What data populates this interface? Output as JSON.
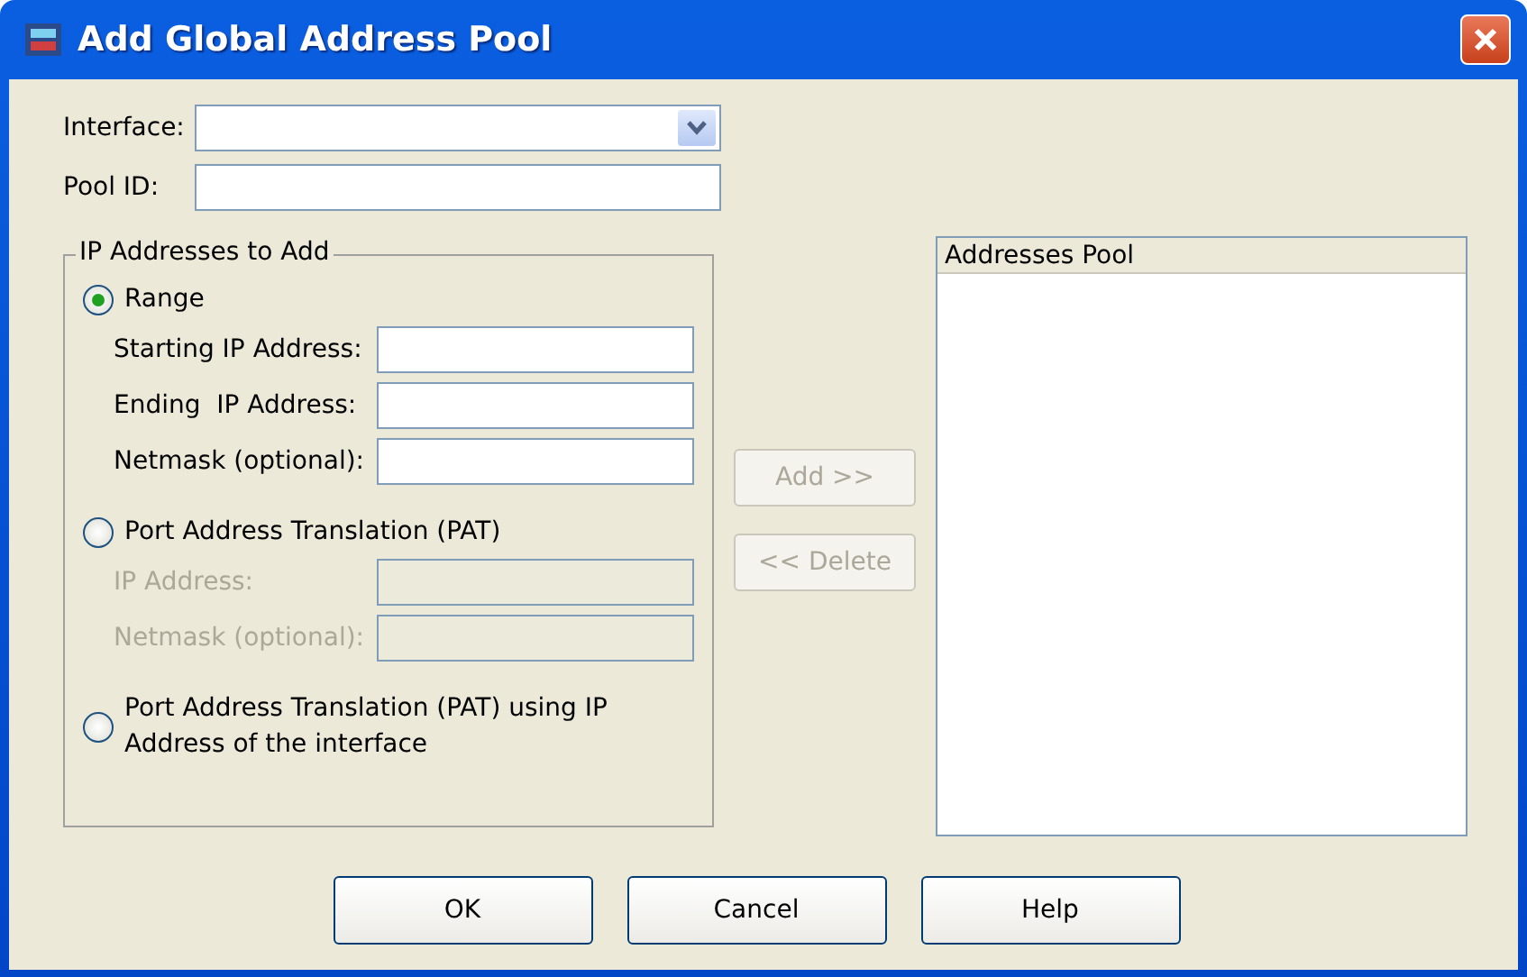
{
  "window": {
    "title": "Add Global Address Pool"
  },
  "interface": {
    "label": "Interface:"
  },
  "pool_id": {
    "label": "Pool ID:"
  },
  "ip_group": {
    "title": "IP Addresses to Add",
    "options": [
      {
        "label": "Range",
        "selected": true,
        "fields": [
          {
            "label": "Starting IP Address:",
            "disabled": false
          },
          {
            "label": "Ending  IP Address:",
            "disabled": false
          },
          {
            "label": "Netmask (optional):",
            "disabled": false
          }
        ]
      },
      {
        "label": "Port Address Translation (PAT)",
        "selected": false,
        "fields": [
          {
            "label": "IP Address:",
            "disabled": true
          },
          {
            "label": "Netmask (optional):",
            "disabled": true
          }
        ]
      },
      {
        "label": "Port Address Translation (PAT) using IP Address of the interface",
        "selected": false
      }
    ]
  },
  "move_buttons": [
    {
      "label": "Add >>",
      "disabled": true
    },
    {
      "label": "<< Delete",
      "disabled": true
    }
  ],
  "addresses_pool": {
    "header": "Addresses Pool"
  },
  "buttons": [
    {
      "label": "OK"
    },
    {
      "label": "Cancel"
    },
    {
      "label": "Help"
    }
  ]
}
